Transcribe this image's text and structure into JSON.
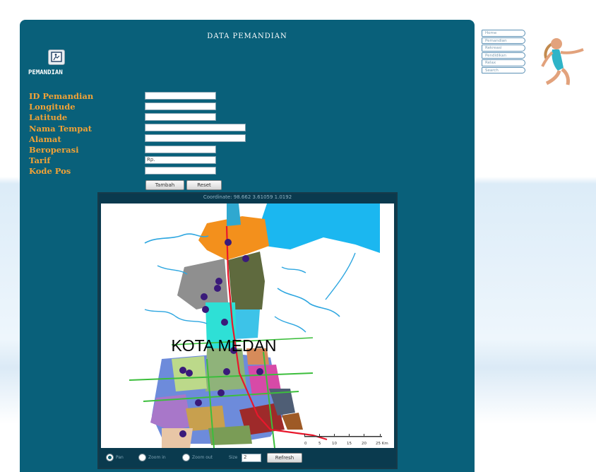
{
  "page": {
    "title": "DATA PEMANDIAN",
    "logo_text": "PEMANDIAN"
  },
  "form": {
    "fields": [
      {
        "label": "ID Pemandian",
        "value": ""
      },
      {
        "label": "Longitude",
        "value": ""
      },
      {
        "label": "Latitude",
        "value": ""
      },
      {
        "label": "Nama Tempat",
        "value": ""
      },
      {
        "label": "Alamat",
        "value": ""
      },
      {
        "label": "Beroperasi",
        "value": ""
      },
      {
        "label": "Tarif",
        "value": "Rp."
      },
      {
        "label": "Kode Pos",
        "value": ""
      }
    ],
    "tambah_label": "Tambah",
    "reset_label": "Reset"
  },
  "map": {
    "caption": "Coordinate:  98.662    3.61059    1.0192",
    "city_label": "KOTA MEDAN",
    "scale_ticks": [
      "0",
      "5",
      "10",
      "15",
      "20",
      "25 Km"
    ],
    "colors": {
      "sea": "#1bb7f0",
      "river": "#2da6e0",
      "road_main": "#e8172c",
      "road_green": "#3cbe3c",
      "marker": "#3a1a7a"
    }
  },
  "controls": {
    "radio_1": "Pan",
    "radio_2": "Zoom in",
    "radio_3": "Zoom out",
    "size_label": "Size",
    "size_value": "2",
    "refresh_label": "Refresh"
  },
  "nav": {
    "items": [
      "Home",
      "Pemandian",
      "Rekreasi",
      "Pendidikan",
      "Relax",
      "Search"
    ]
  },
  "theme": {
    "panel": "#09607a",
    "label": "#f1a236"
  }
}
